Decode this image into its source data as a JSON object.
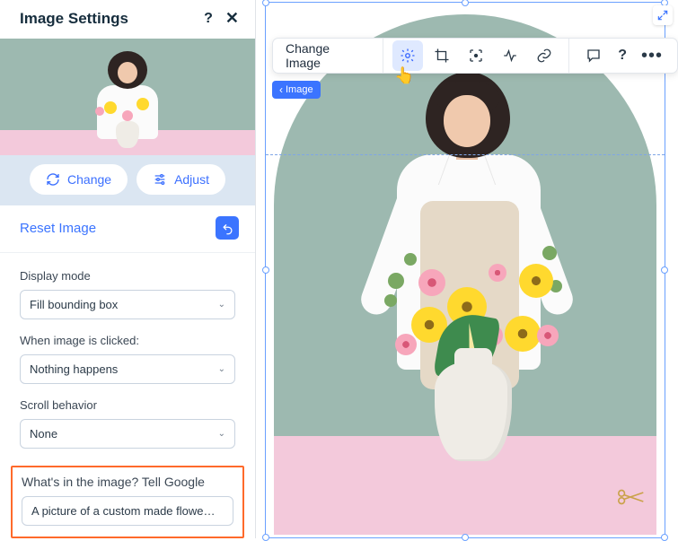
{
  "panel": {
    "title": "Image Settings",
    "help_glyph": "?",
    "close_glyph": "✕",
    "change_label": "Change",
    "adjust_label": "Adjust",
    "reset_label": "Reset Image"
  },
  "fields": {
    "display_mode": {
      "label": "Display mode",
      "value": "Fill bounding box"
    },
    "click_action": {
      "label": "When image is clicked:",
      "value": "Nothing happens"
    },
    "scroll_behavior": {
      "label": "Scroll behavior",
      "value": "None"
    },
    "alt_text": {
      "label": "What's in the image? Tell Google",
      "value": "A picture of a custom made flowe…"
    }
  },
  "toolbar": {
    "change_image": "Change Image",
    "help_glyph": "?",
    "more_glyph": "•••"
  },
  "badge": {
    "label": "Image"
  },
  "colors": {
    "accent": "#3b74ff",
    "highlight": "#ff6a2b"
  }
}
